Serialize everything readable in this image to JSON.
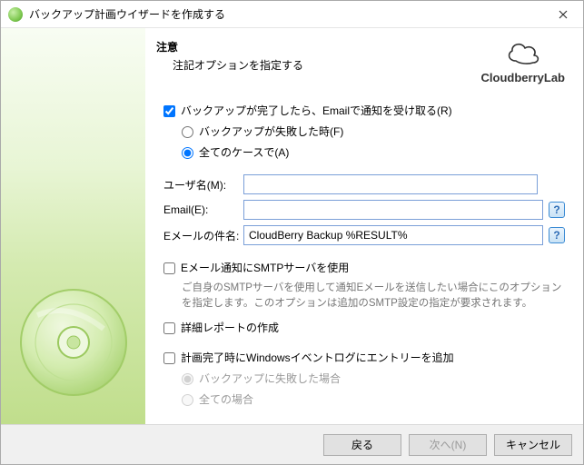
{
  "window": {
    "title": "バックアップ計画ウイザードを作成する"
  },
  "brand": {
    "name": "CloudberryLab"
  },
  "header": {
    "title": "注意",
    "subtitle": "注記オプションを指定する"
  },
  "notify": {
    "receive_email_label": "バックアップが完了したら、Emailで通知を受け取る(R)",
    "when_failed_label": "バックアップが失敗した時(F)",
    "all_cases_label": "全てのケースで(A)"
  },
  "fields": {
    "username_label": "ユーザ名(M):",
    "username_value": "",
    "email_label": "Email(E):",
    "email_value": "",
    "subject_label": "Eメールの件名:",
    "subject_value": "CloudBerry Backup %RESULT%"
  },
  "smtp": {
    "label": "Eメール通知にSMTPサーバを使用",
    "desc": "ご自身のSMTPサーバを使用して通知Eメールを送信したい場合にこのオプションを指定します。このオプションは追加のSMTP設定の指定が要求されます。"
  },
  "detailed_report_label": "詳細レポートの作成",
  "eventlog": {
    "label": "計画完了時にWindowsイベントログにエントリーを追加",
    "when_failed_label": "バックアップに失敗した場合",
    "all_cases_label": "全ての場合"
  },
  "buttons": {
    "back": "戻る",
    "next": "次へ(N)",
    "cancel": "キャンセル"
  }
}
